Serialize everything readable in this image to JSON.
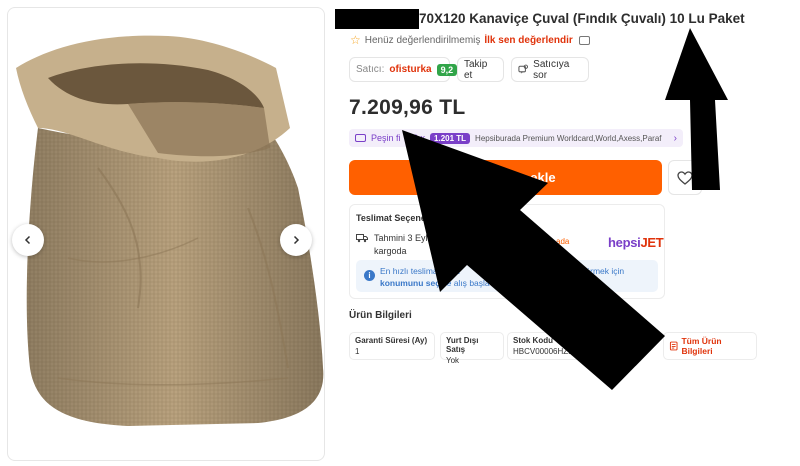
{
  "product": {
    "title": "70X120 Kanaviçe Çuval (Fındık Çuvalı) 10 Lu Paket",
    "rating_text": "Henüz değerlendirilmemiş",
    "first_review_link": "İlk sen değerlendir",
    "price": "7.209,96 TL"
  },
  "seller": {
    "label": "Satıcı:",
    "name": "ofisturka",
    "score": "9,2",
    "follow_label": "Takip et",
    "ask_label": "Satıcıya sor"
  },
  "installment": {
    "text": "Peşin fi",
    "text_tail": "a 6 x",
    "amount": "1.201 TL",
    "banks": "Hepsiburada Premium Worldcard,World,Axess,Paraf"
  },
  "cart": {
    "add_label_visible": "e ekle"
  },
  "delivery": {
    "title": "Teslimat Seçenekleri",
    "estimate_line1": "Tahmini 3 Eylül Per",
    "estimate_line2": "kargoda",
    "carrier_partial": "ada",
    "carrier_brand_hepsi": "hepsi",
    "carrier_brand_jet": "JET",
    "info_line1_a": "En hızlı teslimat seçe",
    "info_line1_b": "görmek için",
    "info_line2_a": "konumunu seç",
    "info_line2_b": "ve alış",
    "info_line2_c": "başla"
  },
  "product_info": {
    "title": "Ürün Bilgileri",
    "items": [
      {
        "key": "Garanti Süresi (Ay)",
        "value": "1"
      },
      {
        "key": "Yurt Dışı Satış",
        "value": "Yok"
      },
      {
        "key": "Stok Kodu",
        "value": "HBCV00006HZ1TV"
      }
    ],
    "all_info_label": "Tüm Ürün Bilgileri"
  },
  "colors": {
    "accent_orange": "#ff6000",
    "accent_purple": "#7a3fc8",
    "seller_score_green": "#31a549"
  }
}
